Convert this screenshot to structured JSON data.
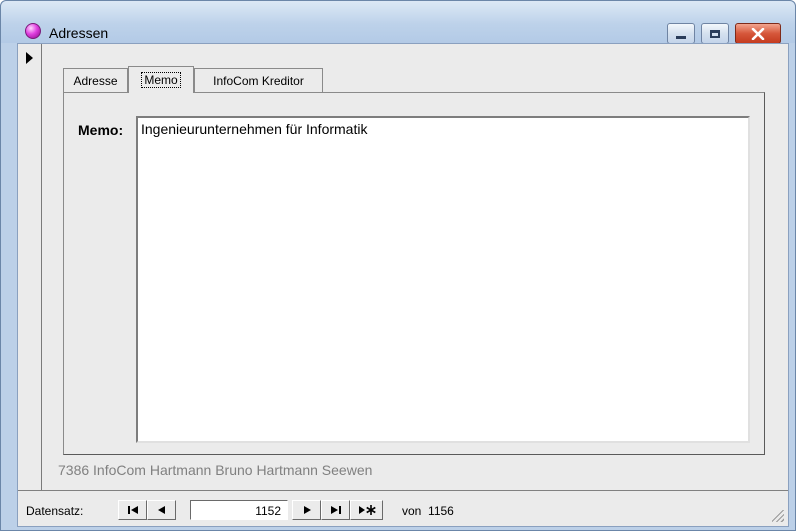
{
  "window": {
    "title": "Adressen",
    "colors": {
      "title_bar": "#bdd2ea",
      "close_button": "#c43b1f",
      "app_icon": "#e040e0"
    }
  },
  "tabs": [
    {
      "label": "Adresse",
      "active": false
    },
    {
      "label": "Memo",
      "active": true
    },
    {
      "label": "InfoCom Kreditor",
      "active": false
    }
  ],
  "memo": {
    "label": "Memo:",
    "value": "Ingenieurunternehmen für Informatik"
  },
  "footer": {
    "text": "7386 InfoCom Hartmann Bruno Hartmann Seewen"
  },
  "navigation": {
    "label": "Datensatz:",
    "current_record": "1152",
    "of_label": "von",
    "total_records": "1156",
    "buttons": {
      "first": "first-record-icon",
      "previous": "previous-record-icon",
      "next": "next-record-icon",
      "last": "last-record-icon",
      "new": "new-record-icon"
    }
  }
}
